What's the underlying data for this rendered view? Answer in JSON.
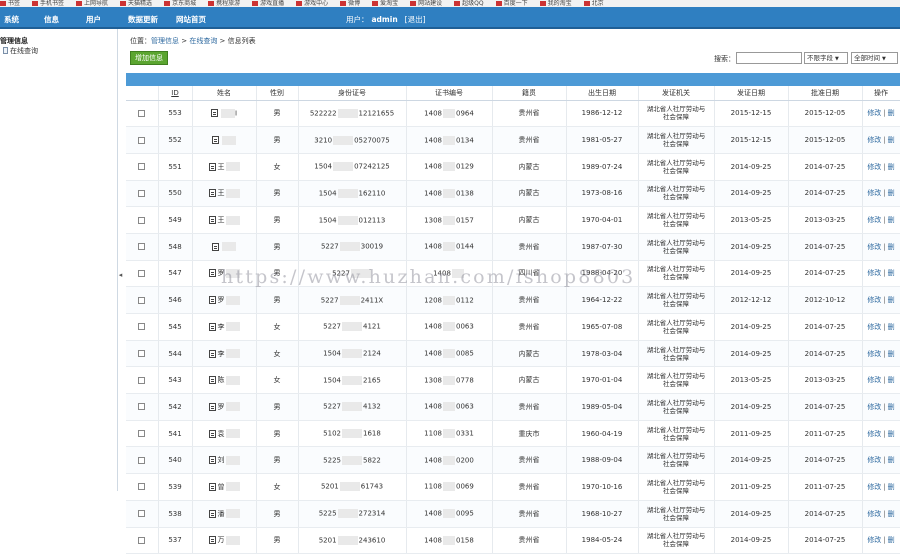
{
  "browser_bookmarks": [
    "书签",
    "手机书签",
    "上网导航",
    "天猫精选",
    "京东商城",
    "携程旅游",
    "游戏直播",
    "游戏中心",
    "微博",
    "爱淘宝",
    "网站建设",
    "超级QQ",
    "百度一下",
    "我的淘宝",
    "北京"
  ],
  "topnav": {
    "items": [
      "系统",
      "信息",
      "用户",
      "数据更新",
      "网站首页"
    ],
    "user_label": "用户：",
    "username": "admin",
    "logout": "[退出]"
  },
  "sidebar": {
    "section_title": "管理信息",
    "items": [
      "在线查询"
    ],
    "collapse_glyph": "◂"
  },
  "breadcrumb": {
    "prefix": "位置：",
    "crumbs": [
      "管理信息",
      "在线查询",
      "信息列表"
    ],
    "sep": " > "
  },
  "toolbar": {
    "add_label": "增加信息",
    "search_label": "搜索：",
    "search_value": "",
    "field_select": "不限字段",
    "time_select": "全部时间"
  },
  "table": {
    "columns": [
      "",
      "ID",
      "姓名",
      "性别",
      "身份证号",
      "证书编号",
      "籍贯",
      "出生日期",
      "发证机关",
      "发证日期",
      "批准日期",
      "操作"
    ],
    "op_edit": "修改",
    "op_delete": "删",
    "rows": [
      {
        "id": "553",
        "name_a": "",
        "name_b": "I",
        "gender": "男",
        "idno_a": "522222",
        "idno_b": "12121655",
        "cert_a": "1408",
        "cert_b": "0964",
        "origin": "贵州省",
        "birth": "1986-12-12",
        "issuer": "湖北省人社厅劳动与社会保障",
        "issue": "2015-12-15",
        "approve": "2015-12-05"
      },
      {
        "id": "552",
        "name_a": "",
        "name_b": "",
        "gender": "男",
        "idno_a": "3210",
        "idno_b": "05270075",
        "cert_a": "1408",
        "cert_b": "0134",
        "origin": "贵州省",
        "birth": "1981-05-27",
        "issuer": "湖北省人社厅劳动与社会保障",
        "issue": "2015-12-15",
        "approve": "2015-12-05"
      },
      {
        "id": "551",
        "name_a": "王",
        "name_b": "",
        "gender": "女",
        "idno_a": "1504",
        "idno_b": "07242125",
        "cert_a": "1408",
        "cert_b": "0129",
        "origin": "内蒙古",
        "birth": "1989-07-24",
        "issuer": "湖北省人社厅劳动与社会保障",
        "issue": "2014-09-25",
        "approve": "2014-07-25"
      },
      {
        "id": "550",
        "name_a": "王",
        "name_b": "",
        "gender": "男",
        "idno_a": "1504",
        "idno_b": "162110",
        "cert_a": "1408",
        "cert_b": "0138",
        "origin": "内蒙古",
        "birth": "1973-08-16",
        "issuer": "湖北省人社厅劳动与社会保障",
        "issue": "2014-09-25",
        "approve": "2014-07-25"
      },
      {
        "id": "549",
        "name_a": "王",
        "name_b": "",
        "gender": "男",
        "idno_a": "1504",
        "idno_b": "012113",
        "cert_a": "1308",
        "cert_b": "0157",
        "origin": "内蒙古",
        "birth": "1970-04-01",
        "issuer": "湖北省人社厅劳动与社会保障",
        "issue": "2013-05-25",
        "approve": "2013-03-25"
      },
      {
        "id": "548",
        "name_a": "",
        "name_b": "",
        "gender": "男",
        "idno_a": "5227",
        "idno_b": "30019",
        "cert_a": "1408",
        "cert_b": "0144",
        "origin": "贵州省",
        "birth": "1987-07-30",
        "issuer": "湖北省人社厅劳动与社会保障",
        "issue": "2014-09-25",
        "approve": "2014-07-25"
      },
      {
        "id": "547",
        "name_a": "罗",
        "name_b": "",
        "gender": "男",
        "idno_a": "5227",
        "idno_b": "",
        "cert_a": "1408",
        "cert_b": "",
        "origin": "四川省",
        "birth": "1988-04-20",
        "issuer": "湖北省人社厅劳动与社会保障",
        "issue": "2014-09-25",
        "approve": "2014-07-25"
      },
      {
        "id": "546",
        "name_a": "罗",
        "name_b": "",
        "gender": "男",
        "idno_a": "5227",
        "idno_b": "2411X",
        "cert_a": "1208",
        "cert_b": "0112",
        "origin": "贵州省",
        "birth": "1964-12-22",
        "issuer": "湖北省人社厅劳动与社会保障",
        "issue": "2012-12-12",
        "approve": "2012-10-12"
      },
      {
        "id": "545",
        "name_a": "李",
        "name_b": "",
        "gender": "女",
        "idno_a": "5227",
        "idno_b": "4121",
        "cert_a": "1408",
        "cert_b": "0063",
        "origin": "贵州省",
        "birth": "1965-07-08",
        "issuer": "湖北省人社厅劳动与社会保障",
        "issue": "2014-09-25",
        "approve": "2014-07-25"
      },
      {
        "id": "544",
        "name_a": "李",
        "name_b": "",
        "gender": "女",
        "idno_a": "1504",
        "idno_b": "2124",
        "cert_a": "1408",
        "cert_b": "0085",
        "origin": "内蒙古",
        "birth": "1978-03-04",
        "issuer": "湖北省人社厅劳动与社会保障",
        "issue": "2014-09-25",
        "approve": "2014-07-25"
      },
      {
        "id": "543",
        "name_a": "陈",
        "name_b": "",
        "gender": "女",
        "idno_a": "1504",
        "idno_b": "2165",
        "cert_a": "1308",
        "cert_b": "0778",
        "origin": "内蒙古",
        "birth": "1970-01-04",
        "issuer": "湖北省人社厅劳动与社会保障",
        "issue": "2013-05-25",
        "approve": "2013-03-25"
      },
      {
        "id": "542",
        "name_a": "罗",
        "name_b": "",
        "gender": "男",
        "idno_a": "5227",
        "idno_b": "4132",
        "cert_a": "1408",
        "cert_b": "0063",
        "origin": "贵州省",
        "birth": "1989-05-04",
        "issuer": "湖北省人社厅劳动与社会保障",
        "issue": "2014-09-25",
        "approve": "2014-07-25"
      },
      {
        "id": "541",
        "name_a": "袁",
        "name_b": "",
        "gender": "男",
        "idno_a": "5102",
        "idno_b": "1618",
        "cert_a": "1108",
        "cert_b": "0331",
        "origin": "重庆市",
        "birth": "1960-04-19",
        "issuer": "湖北省人社厅劳动与社会保障",
        "issue": "2011-09-25",
        "approve": "2011-07-25"
      },
      {
        "id": "540",
        "name_a": "刘",
        "name_b": "",
        "gender": "男",
        "idno_a": "5225",
        "idno_b": "5822",
        "cert_a": "1408",
        "cert_b": "0200",
        "origin": "贵州省",
        "birth": "1988-09-04",
        "issuer": "湖北省人社厅劳动与社会保障",
        "issue": "2014-09-25",
        "approve": "2014-07-25"
      },
      {
        "id": "539",
        "name_a": "曾",
        "name_b": "",
        "gender": "女",
        "idno_a": "5201",
        "idno_b": "61743",
        "cert_a": "1108",
        "cert_b": "0069",
        "origin": "贵州省",
        "birth": "1970-10-16",
        "issuer": "湖北省人社厅劳动与社会保障",
        "issue": "2011-09-25",
        "approve": "2011-07-25"
      },
      {
        "id": "538",
        "name_a": "潘",
        "name_b": "",
        "gender": "男",
        "idno_a": "5225",
        "idno_b": "272314",
        "cert_a": "1408",
        "cert_b": "0095",
        "origin": "贵州省",
        "birth": "1968-10-27",
        "issuer": "湖北省人社厅劳动与社会保障",
        "issue": "2014-09-25",
        "approve": "2014-07-25"
      },
      {
        "id": "537",
        "name_a": "万",
        "name_b": "",
        "gender": "男",
        "idno_a": "5201",
        "idno_b": "243610",
        "cert_a": "1408",
        "cert_b": "0158",
        "origin": "贵州省",
        "birth": "1984-05-24",
        "issuer": "湖北省人社厅劳动与社会保障",
        "issue": "2014-09-25",
        "approve": "2014-07-25"
      }
    ]
  },
  "watermark": "https://www.huzhan.com/ishop8803",
  "colors": {
    "nav_bg": "#2f7fc1",
    "table_header_bar": "#4d9ad6",
    "add_button": "#5ba530",
    "link": "#2f6aa0"
  }
}
